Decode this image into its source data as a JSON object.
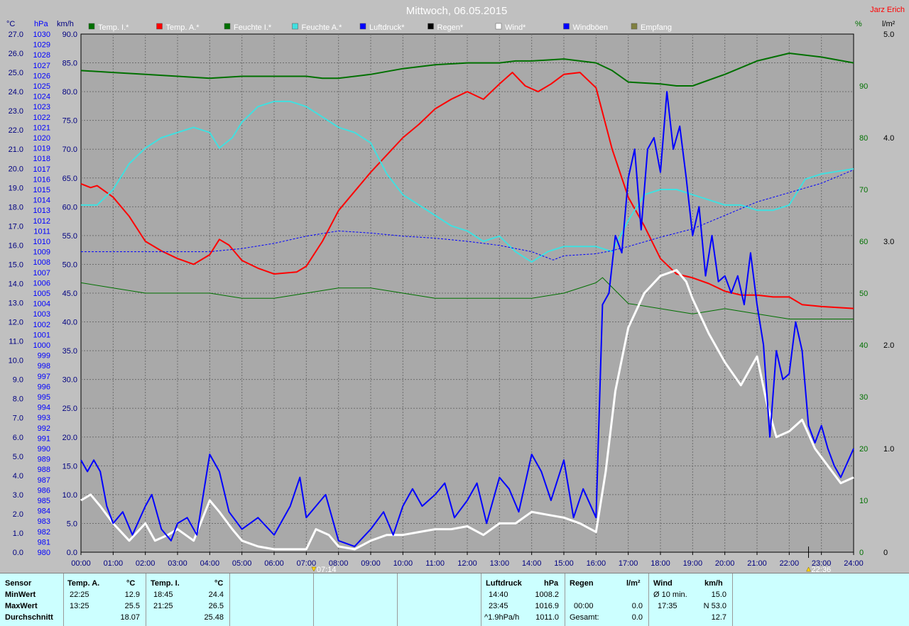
{
  "window": {
    "title": "Mittwoch, 06.05.2015",
    "author": "Jarz Erich"
  },
  "axes": {
    "left_units": [
      "°C",
      "hPa",
      "km/h"
    ],
    "right_units": [
      "%",
      "l/m²"
    ],
    "temp_ticks": [
      "0.0",
      "1.0",
      "2.0",
      "3.0",
      "4.0",
      "5.0",
      "6.0",
      "7.0",
      "8.0",
      "9.0",
      "10.0",
      "11.0",
      "12.0",
      "13.0",
      "14.0",
      "15.0",
      "16.0",
      "17.0",
      "18.0",
      "19.0",
      "20.0",
      "21.0",
      "22.0",
      "23.0",
      "24.0",
      "25.0",
      "26.0",
      "27.0"
    ],
    "hpa_ticks": [
      "980",
      "981",
      "982",
      "983",
      "984",
      "985",
      "986",
      "987",
      "988",
      "989",
      "990",
      "991",
      "992",
      "993",
      "994",
      "995",
      "996",
      "997",
      "998",
      "999",
      "1000",
      "1001",
      "1002",
      "1003",
      "1004",
      "1005",
      "1006",
      "1007",
      "1008",
      "1009",
      "1010",
      "1011",
      "1012",
      "1013",
      "1014",
      "1015",
      "1016",
      "1017",
      "1018",
      "1019",
      "1020",
      "1021",
      "1022",
      "1023",
      "1024",
      "1025",
      "1026",
      "1027",
      "1028",
      "1029",
      "1030"
    ],
    "kmh_ticks": [
      "0.0",
      "5.0",
      "10.0",
      "15.0",
      "20.0",
      "25.0",
      "30.0",
      "35.0",
      "40.0",
      "45.0",
      "50.0",
      "55.0",
      "60.0",
      "65.0",
      "70.0",
      "75.0",
      "80.0",
      "85.0",
      "90.0"
    ],
    "pct_ticks": [
      "0",
      "10",
      "20",
      "30",
      "40",
      "50",
      "60",
      "70",
      "80",
      "90"
    ],
    "rain_ticks": [
      "0",
      "1.0",
      "2.0",
      "3.0",
      "4.0",
      "5.0"
    ],
    "time_ticks": [
      "00:00",
      "01:00",
      "02:00",
      "03:00",
      "04:00",
      "05:00",
      "06:00",
      "07:00",
      "08:00",
      "09:00",
      "10:00",
      "11:00",
      "12:00",
      "13:00",
      "14:00",
      "15:00",
      "16:00",
      "17:00",
      "18:00",
      "19:00",
      "20:00",
      "21:00",
      "22:00",
      "23:00",
      "24:00"
    ],
    "sunrise": "07:14",
    "sunset": "22:36"
  },
  "chart_data": {
    "type": "line",
    "title": "Mittwoch, 06.05.2015",
    "x_unit": "hours",
    "xlim": [
      0,
      24
    ],
    "ylim_temp": [
      0,
      27
    ],
    "ylim_hpa": [
      980,
      1030
    ],
    "ylim_kmh": [
      0,
      90
    ],
    "ylim_pct": [
      0,
      100
    ],
    "ylim_rain": [
      0,
      5
    ],
    "grid": true,
    "legend_position": "top",
    "series": [
      {
        "name": "Temp. I.*",
        "axis": "temp",
        "color": "#007000",
        "legend_color": "#007000",
        "width": 2,
        "dash": "",
        "x": [
          0,
          1,
          2,
          3,
          4,
          5,
          6,
          7,
          7.5,
          8,
          9,
          10,
          11,
          12,
          12.5,
          13,
          13.5,
          14,
          15,
          16,
          16.5,
          17,
          18,
          18.5,
          19,
          20,
          21,
          22,
          23,
          24
        ],
        "y": [
          25.1,
          25.0,
          24.9,
          24.8,
          24.7,
          24.8,
          24.8,
          24.8,
          24.7,
          24.7,
          24.9,
          25.2,
          25.4,
          25.5,
          25.5,
          25.5,
          25.6,
          25.6,
          25.7,
          25.5,
          25.1,
          24.5,
          24.4,
          24.3,
          24.3,
          24.9,
          25.6,
          26.0,
          25.8,
          25.5
        ]
      },
      {
        "name": "Temp. A.*",
        "axis": "temp",
        "color": "#ff0000",
        "legend_color": "#ff0000",
        "width": 2,
        "dash": "",
        "x": [
          0,
          0.3,
          0.5,
          1,
          1.5,
          2,
          2.5,
          3,
          3.5,
          4,
          4.3,
          4.6,
          5,
          5.5,
          6,
          6.7,
          7,
          7.5,
          8,
          8.5,
          9,
          9.5,
          10,
          10.5,
          11,
          11.5,
          12,
          12.5,
          13,
          13.4,
          13.8,
          14.2,
          14.6,
          15,
          15.5,
          16,
          16.5,
          17,
          17.5,
          18,
          18.5,
          19,
          19.5,
          20,
          20.5,
          21,
          21.5,
          22,
          22.4,
          23,
          24
        ],
        "y": [
          19.2,
          19.0,
          19.1,
          18.5,
          17.5,
          16.2,
          15.7,
          15.3,
          15.0,
          15.5,
          16.3,
          16.0,
          15.2,
          14.8,
          14.5,
          14.6,
          14.9,
          16.2,
          17.8,
          18.8,
          19.8,
          20.7,
          21.6,
          22.3,
          23.1,
          23.6,
          24.0,
          23.6,
          24.4,
          25.0,
          24.3,
          24.0,
          24.4,
          24.9,
          25.0,
          24.2,
          21.0,
          18.5,
          17.0,
          15.3,
          14.5,
          14.3,
          14.0,
          13.6,
          13.4,
          13.4,
          13.3,
          13.3,
          12.9,
          12.8,
          12.7
        ]
      },
      {
        "name": "Feuchte I.*",
        "axis": "pct",
        "color": "#007000",
        "legend_color": "#007000",
        "width": 1,
        "dash": "",
        "x": [
          0,
          1,
          2,
          3,
          4,
          5,
          6,
          7,
          8,
          9,
          10,
          11,
          12,
          13,
          14,
          15,
          16,
          16.2,
          17,
          18,
          19,
          20,
          21,
          22,
          23,
          24
        ],
        "y": [
          52,
          51,
          50,
          50,
          50,
          49,
          49,
          50,
          51,
          51,
          50,
          49,
          49,
          49,
          49,
          50,
          52,
          53,
          48,
          47,
          46,
          47,
          46,
          45,
          45,
          45
        ]
      },
      {
        "name": "Feuchte A.*",
        "axis": "pct",
        "color": "#40e0e0",
        "legend_color": "#40e0e0",
        "width": 2,
        "dash": "",
        "x": [
          0,
          0.5,
          1,
          1.5,
          2,
          2.5,
          3,
          3.5,
          4,
          4.3,
          4.7,
          5,
          5.5,
          6,
          6.5,
          7,
          7.5,
          8,
          8.5,
          9,
          9.5,
          10,
          10.5,
          11,
          11.5,
          12,
          12.5,
          13,
          13.5,
          14,
          14.5,
          15,
          15.5,
          16,
          16.5,
          17,
          17.5,
          18,
          18.5,
          19,
          19.5,
          20,
          20.5,
          21,
          21.5,
          22,
          22.5,
          23,
          24
        ],
        "y": [
          67,
          67,
          70,
          75,
          78,
          80,
          81,
          82,
          81,
          78,
          80,
          83,
          86,
          87,
          87,
          86,
          84,
          82,
          81,
          79,
          73,
          69,
          67,
          65,
          63,
          62,
          60,
          61,
          58,
          56,
          58,
          59,
          59,
          59,
          58,
          64,
          69,
          70,
          70,
          69,
          68,
          67,
          67,
          66,
          66,
          67,
          72,
          73,
          74
        ]
      },
      {
        "name": "Luftdruck*",
        "axis": "hpa",
        "color": "#0000ff",
        "legend_color": "#0000ff",
        "width": 1,
        "dash": "3,2",
        "x": [
          0,
          1,
          2,
          3,
          4,
          5,
          6,
          7,
          8,
          9,
          10,
          11,
          12,
          13,
          14,
          14.67,
          15,
          16,
          16.5,
          17,
          18,
          19,
          20,
          21,
          22,
          23,
          24
        ],
        "y": [
          1009,
          1009,
          1009,
          1009,
          1009,
          1009.3,
          1009.8,
          1010.5,
          1011,
          1010.8,
          1010.5,
          1010.3,
          1010,
          1009.6,
          1009,
          1008.2,
          1008.6,
          1008.8,
          1009.1,
          1009.5,
          1010.4,
          1011.2,
          1012.5,
          1013.8,
          1014.7,
          1015.6,
          1016.9
        ]
      },
      {
        "name": "Regen*",
        "axis": "rain",
        "color": "#000000",
        "legend_color": "#000000",
        "width": 1,
        "dash": "",
        "x": [
          0,
          24
        ],
        "y": [
          0,
          0
        ]
      },
      {
        "name": "Wind*",
        "axis": "kmh",
        "color": "#ffffff",
        "legend_color": "#ffffff",
        "width": 3,
        "dash": "",
        "x": [
          0,
          0.3,
          0.6,
          1,
          1.5,
          2,
          2.3,
          2.7,
          3,
          3.5,
          4,
          4.3,
          4.7,
          5,
          5.5,
          6,
          6.5,
          7,
          7.3,
          7.7,
          8,
          8.5,
          9,
          9.5,
          10,
          10.5,
          11,
          11.5,
          12,
          12.5,
          13,
          13.5,
          14,
          14.5,
          15,
          15.5,
          16,
          16.3,
          16.6,
          17,
          17.5,
          18,
          18.5,
          18.8,
          19,
          19.5,
          20,
          20.5,
          21,
          21.3,
          21.6,
          22,
          22.4,
          22.8,
          23.2,
          23.6,
          24
        ],
        "y": [
          9,
          10,
          8,
          5,
          2,
          5,
          2,
          3,
          4,
          2,
          9,
          7,
          4,
          2,
          1,
          0.5,
          0.5,
          0.5,
          4,
          3,
          1,
          0.5,
          2,
          3,
          3,
          3.5,
          4,
          4,
          4.5,
          3,
          5,
          5,
          7,
          6.5,
          6,
          5,
          3.5,
          14,
          28,
          39,
          45,
          48,
          49,
          47,
          44,
          38,
          33,
          29,
          34,
          26,
          20,
          21,
          23,
          18,
          15,
          12,
          13
        ]
      },
      {
        "name": "Windböen",
        "axis": "kmh",
        "color": "#0000ff",
        "legend_color": "#0000ff",
        "width": 2,
        "dash": "",
        "x": [
          0,
          0.2,
          0.4,
          0.6,
          0.8,
          1,
          1.3,
          1.6,
          2,
          2.2,
          2.5,
          2.8,
          3,
          3.3,
          3.6,
          4,
          4.3,
          4.6,
          5,
          5.5,
          6,
          6.5,
          6.8,
          7,
          7.3,
          7.6,
          8,
          8.5,
          9,
          9.4,
          9.7,
          10,
          10.3,
          10.6,
          11,
          11.3,
          11.6,
          12,
          12.3,
          12.6,
          13,
          13.3,
          13.6,
          14,
          14.3,
          14.6,
          15,
          15.3,
          15.6,
          16,
          16.2,
          16.4,
          16.6,
          16.8,
          17,
          17.2,
          17.4,
          17.6,
          17.8,
          18,
          18.2,
          18.4,
          18.6,
          18.8,
          19,
          19.2,
          19.4,
          19.6,
          19.8,
          20,
          20.2,
          20.4,
          20.6,
          20.8,
          21,
          21.2,
          21.4,
          21.6,
          21.8,
          22,
          22.2,
          22.4,
          22.6,
          22.8,
          23,
          23.2,
          23.4,
          23.6,
          24
        ],
        "y": [
          16,
          14,
          16,
          14,
          8,
          5,
          7,
          3,
          8,
          10,
          4,
          2,
          5,
          6,
          3,
          17,
          14,
          7,
          4,
          6,
          3,
          8,
          13,
          6,
          8,
          10,
          2,
          1,
          4,
          7,
          3,
          8,
          11,
          8,
          10,
          12,
          6,
          9,
          12,
          5,
          13,
          11,
          7,
          17,
          14,
          9,
          16,
          6,
          11,
          6,
          43,
          45,
          55,
          52,
          65,
          70,
          56,
          70,
          72,
          66,
          80,
          70,
          74,
          65,
          55,
          60,
          48,
          55,
          47,
          48,
          45,
          48,
          43,
          52,
          43,
          36,
          20,
          35,
          30,
          31,
          40,
          35,
          22,
          19,
          22,
          18,
          15,
          13,
          18
        ]
      },
      {
        "name": "Empfang",
        "axis": "pct",
        "color": "#808040",
        "legend_color": "#808040",
        "width": 1,
        "dash": "",
        "x": [],
        "y": []
      }
    ]
  },
  "stats": {
    "sensor_label": "Sensor",
    "row_labels": [
      "MinWert",
      "MaxWert",
      "Durchschnitt"
    ],
    "temp_a": {
      "header": "Temp. A.",
      "unit": "°C",
      "min_time": "22:25",
      "min": "12.9",
      "max_time": "13:25",
      "max": "25.5",
      "avg": "18.07"
    },
    "temp_i": {
      "header": "Temp. I.",
      "unit": "°C",
      "min_time": "18:45",
      "min": "24.4",
      "max_time": "21:25",
      "max": "26.5",
      "avg": "25.48"
    },
    "luftdruck": {
      "header": "Luftdruck",
      "unit": "hPa",
      "min_time": "14:40",
      "min": "1008.2",
      "max_time": "23:45",
      "max": "1016.9",
      "trend": "^1.9hPa/h",
      "avg": "1011.0"
    },
    "regen": {
      "header": "Regen",
      "unit": "l/m²",
      "time": "00:00",
      "value": "0.0",
      "total_label": "Gesamt:",
      "total": "0.0"
    },
    "wind": {
      "header": "Wind",
      "unit": "km/h",
      "avg_label": "Ø 10 min.",
      "avg": "15.0",
      "gust_time": "17:35",
      "gust": "N 53.0",
      "day_avg": "12.7"
    }
  }
}
